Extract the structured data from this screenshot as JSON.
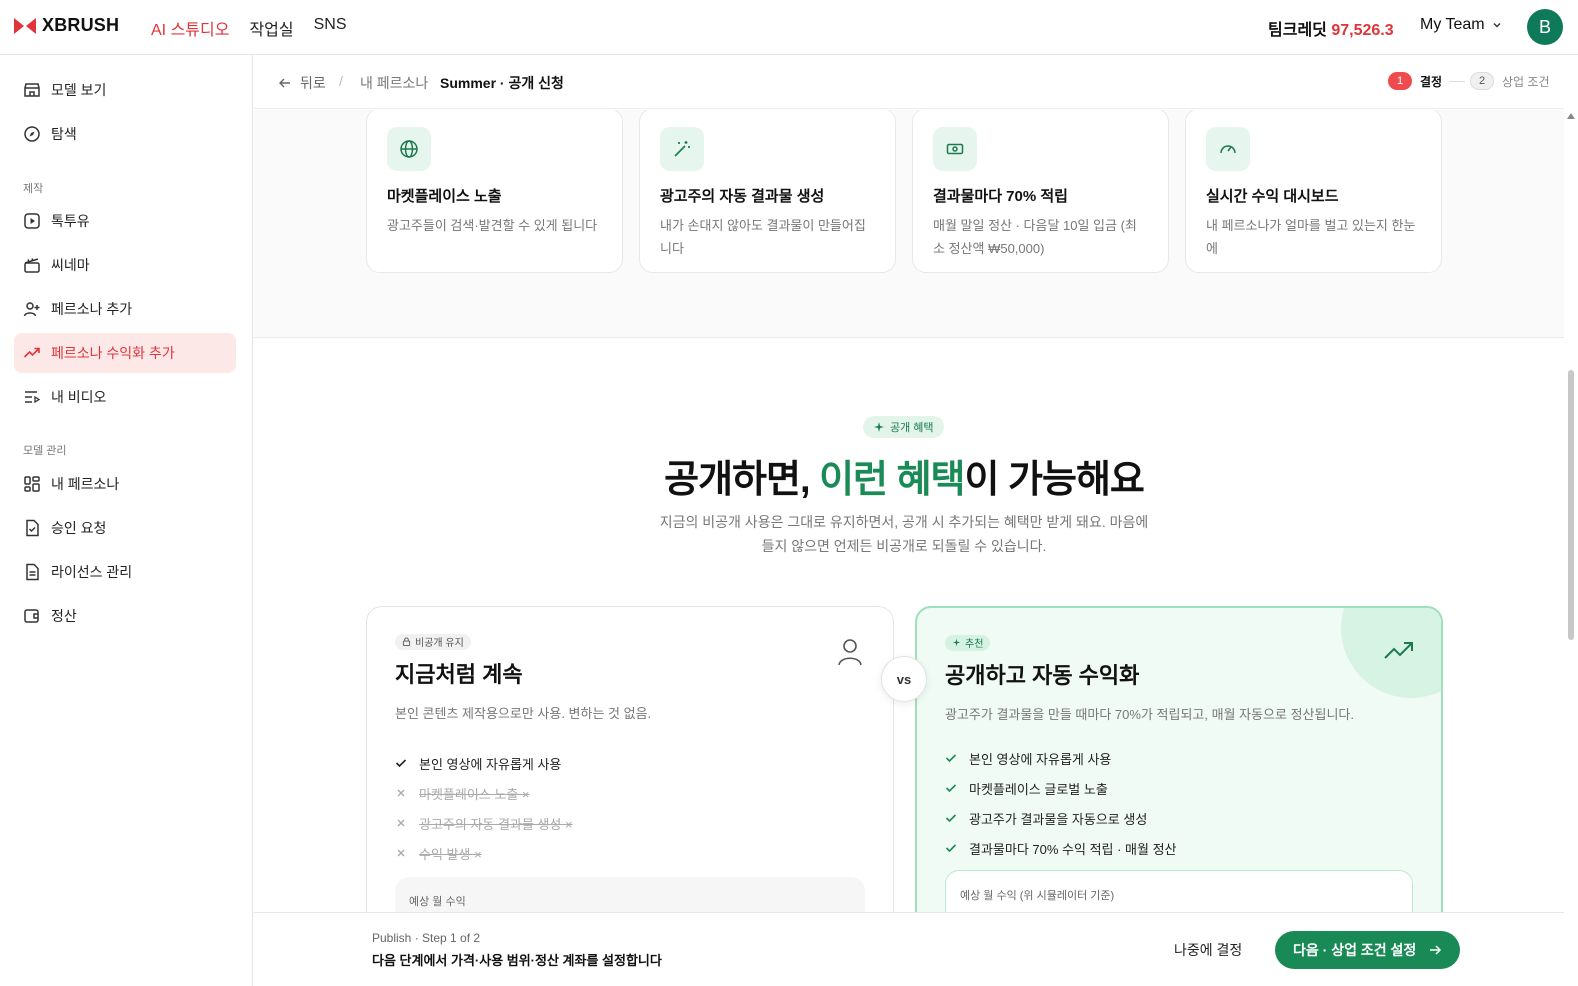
{
  "header": {
    "brand": "XBRUSH",
    "nav": [
      "AI 스튜디오",
      "작업실",
      "SNS"
    ],
    "credit_label": "팀크레딧",
    "credit_value": "97,526.3",
    "team": "My Team",
    "avatar_letter": "B"
  },
  "sidebar": {
    "items_top": [
      {
        "label": "모델 보기",
        "icon": "store-icon"
      },
      {
        "label": "탐색",
        "icon": "compass-icon"
      }
    ],
    "section1": "제작",
    "items_make": [
      {
        "label": "톡투유",
        "icon": "play-icon"
      },
      {
        "label": "씨네마",
        "icon": "clapper-icon"
      },
      {
        "label": "페르소나 추가",
        "icon": "user-plus-icon"
      },
      {
        "label": "페르소나 수익화 추가",
        "icon": "trend-icon",
        "active": true
      },
      {
        "label": "내 비디오",
        "icon": "list-video-icon"
      }
    ],
    "section2": "모델 관리",
    "items_manage": [
      {
        "label": "내 페르소나",
        "icon": "grid-icon"
      },
      {
        "label": "승인 요청",
        "icon": "file-check-icon"
      },
      {
        "label": "라이선스 관리",
        "icon": "file-text-icon"
      },
      {
        "label": "정산",
        "icon": "wallet-icon"
      }
    ]
  },
  "crumbs": {
    "back": "뒤로",
    "sep": "/",
    "parent": "내 페르소나",
    "current": "Summer · 공개 신청",
    "step1_num": "1",
    "step1_label": "결정",
    "step2_num": "2",
    "step2_label": "상업 조건"
  },
  "features": [
    {
      "title": "마켓플레이스 노출",
      "desc": "광고주들이 검색·발견할 수 있게 됩니다",
      "icon": "globe-icon"
    },
    {
      "title": "광고주의 자동 결과물 생성",
      "desc": "내가 손대지 않아도 결과물이 만들어집니다",
      "icon": "magic-wand-icon"
    },
    {
      "title": "결과물마다 70% 적립",
      "desc": "매월 말일 정산 · 다음달 10일 입금 (최소 정산액 ₩50,000)",
      "icon": "banknote-icon"
    },
    {
      "title": "실시간 수익 대시보드",
      "desc": "내 페르소나가 얼마를 벌고 있는지 한눈에",
      "icon": "gauge-icon"
    }
  ],
  "benefits": {
    "pill": "공개 혜택",
    "headline_a": "공개하면, ",
    "headline_hl": "이런 혜택",
    "headline_b": "이 가능해요",
    "sub": "지금의 비공개 사용은 그대로 유지하면서, 공개 시 추가되는 혜택만 받게 돼요. 마음에 들지 않으면 언제든 비공개로 되돌릴 수 있습니다."
  },
  "compare": {
    "vs": "vs",
    "left": {
      "tag": "비공개 유지",
      "title": "지금처럼 계속",
      "desc": "본인 콘텐츠 제작용으로만 사용. 변하는 것 없음.",
      "items": [
        {
          "text": "본인 영상에 자유롭게 사용",
          "on": true
        },
        {
          "text": "마켓플레이스 노출 ×",
          "on": false
        },
        {
          "text": "광고주의 자동 결과물 생성 ×",
          "on": false
        },
        {
          "text": "수익 발생 ×",
          "on": false
        }
      ],
      "estimate": "예상 월 수익"
    },
    "right": {
      "tag": "추천",
      "title": "공개하고 자동 수익화",
      "desc": "광고주가 결과물을 만들 때마다 70%가 적립되고, 매월 자동으로 정산됩니다.",
      "items": [
        {
          "text": "본인 영상에 자유롭게 사용",
          "on": true
        },
        {
          "text": "마켓플레이스 글로벌 노출",
          "on": true
        },
        {
          "text": "광고주가 결과물을 자동으로 생성",
          "on": true
        },
        {
          "text": "결과물마다 70% 수익 적립 · 매월 정산",
          "on": true
        }
      ],
      "estimate": "예상 월 수익 (위 시뮬레이터 기준)"
    }
  },
  "footer": {
    "caption": "Publish · Step 1 of 2",
    "main": "다음 단계에서 가격·사용 범위·정산 계좌를 설정합니다",
    "later": "나중에 결정",
    "next": "다음 · 상업 조건 설정"
  },
  "colors": {
    "accent_red": "#e0343a",
    "accent_green": "#198a56"
  }
}
